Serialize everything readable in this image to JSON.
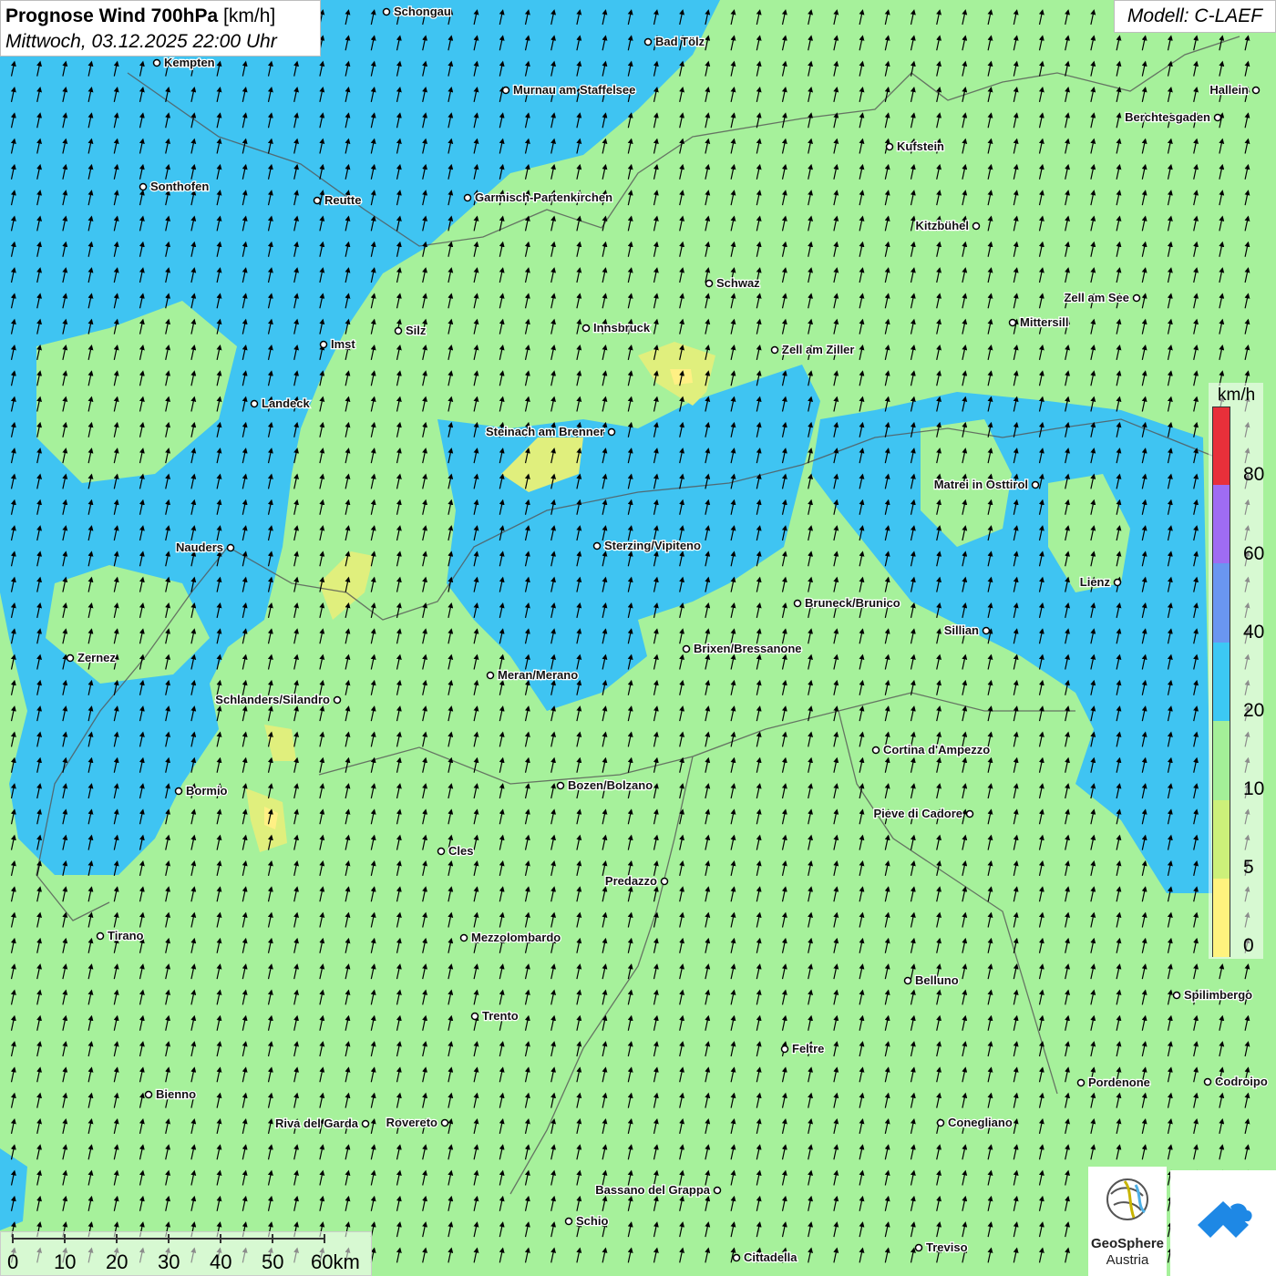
{
  "header": {
    "title_bold": "Prognose Wind 700hPa",
    "title_unit": "[km/h]",
    "subtitle": "Mittwoch, 03.12.2025 22:00 Uhr",
    "model": "Modell: C-LAEF"
  },
  "legend": {
    "unit": "km/h",
    "ticks": [
      "80",
      "60",
      "40",
      "20",
      "10",
      "5",
      "0"
    ],
    "colors": [
      "#e8303a",
      "#9f6cf2",
      "#6a96f0",
      "#3cc8f4",
      "#a4ef98",
      "#ccf07a",
      "#fff37e"
    ]
  },
  "scale_bar": {
    "labels": [
      "0",
      "10",
      "20",
      "30",
      "40",
      "50",
      "60km"
    ]
  },
  "logos": {
    "geosphere_line1": "GeoSphere",
    "geosphere_line2": "Austria"
  },
  "colors": {
    "wind_10_20": "#a6f19b",
    "wind_20_40": "#3fc4f2",
    "wind_5_10": "#e0ef7d",
    "wind_0_5": "#fff084"
  },
  "wind_direction": "north-northeast arrows (from south-southwest)",
  "cities": [
    "Schongau",
    "Bad Tölz",
    "Kempten",
    "Murnau am Staffelsee",
    "Hallein",
    "Berchtesgaden",
    "Kufstein",
    "Sonthofen",
    "Reutte",
    "Garmisch-Partenkirchen",
    "Kitzbühel",
    "Schwaz",
    "Zell am See",
    "Mittersill",
    "Innsbruck",
    "Imst",
    "Silz",
    "Zell am Ziller",
    "Landeck",
    "Steinach am Brenner",
    "Matrei in Osttirol",
    "Nauders",
    "Sterzing/Vipiteno",
    "Lienz",
    "Bruneck/Brunico",
    "Sillian",
    "Zernez",
    "Brixen/Bressanone",
    "Meran/Merano",
    "Schlanders/Silandro",
    "Cortina d'Ampezzo",
    "Bozen/Bolzano",
    "Bormio",
    "Pieve di Cadore",
    "Cles",
    "Predazzo",
    "Tirano",
    "Mezzolombardo",
    "Belluno",
    "Spilimbergo",
    "Trento",
    "Feltre",
    "Pordenone",
    "Codroipo",
    "Bienno",
    "Riva del Garda",
    "Rovereto",
    "Conegliano",
    "Bassano del Grappa",
    "Schio",
    "Treviso",
    "Cittadella"
  ]
}
